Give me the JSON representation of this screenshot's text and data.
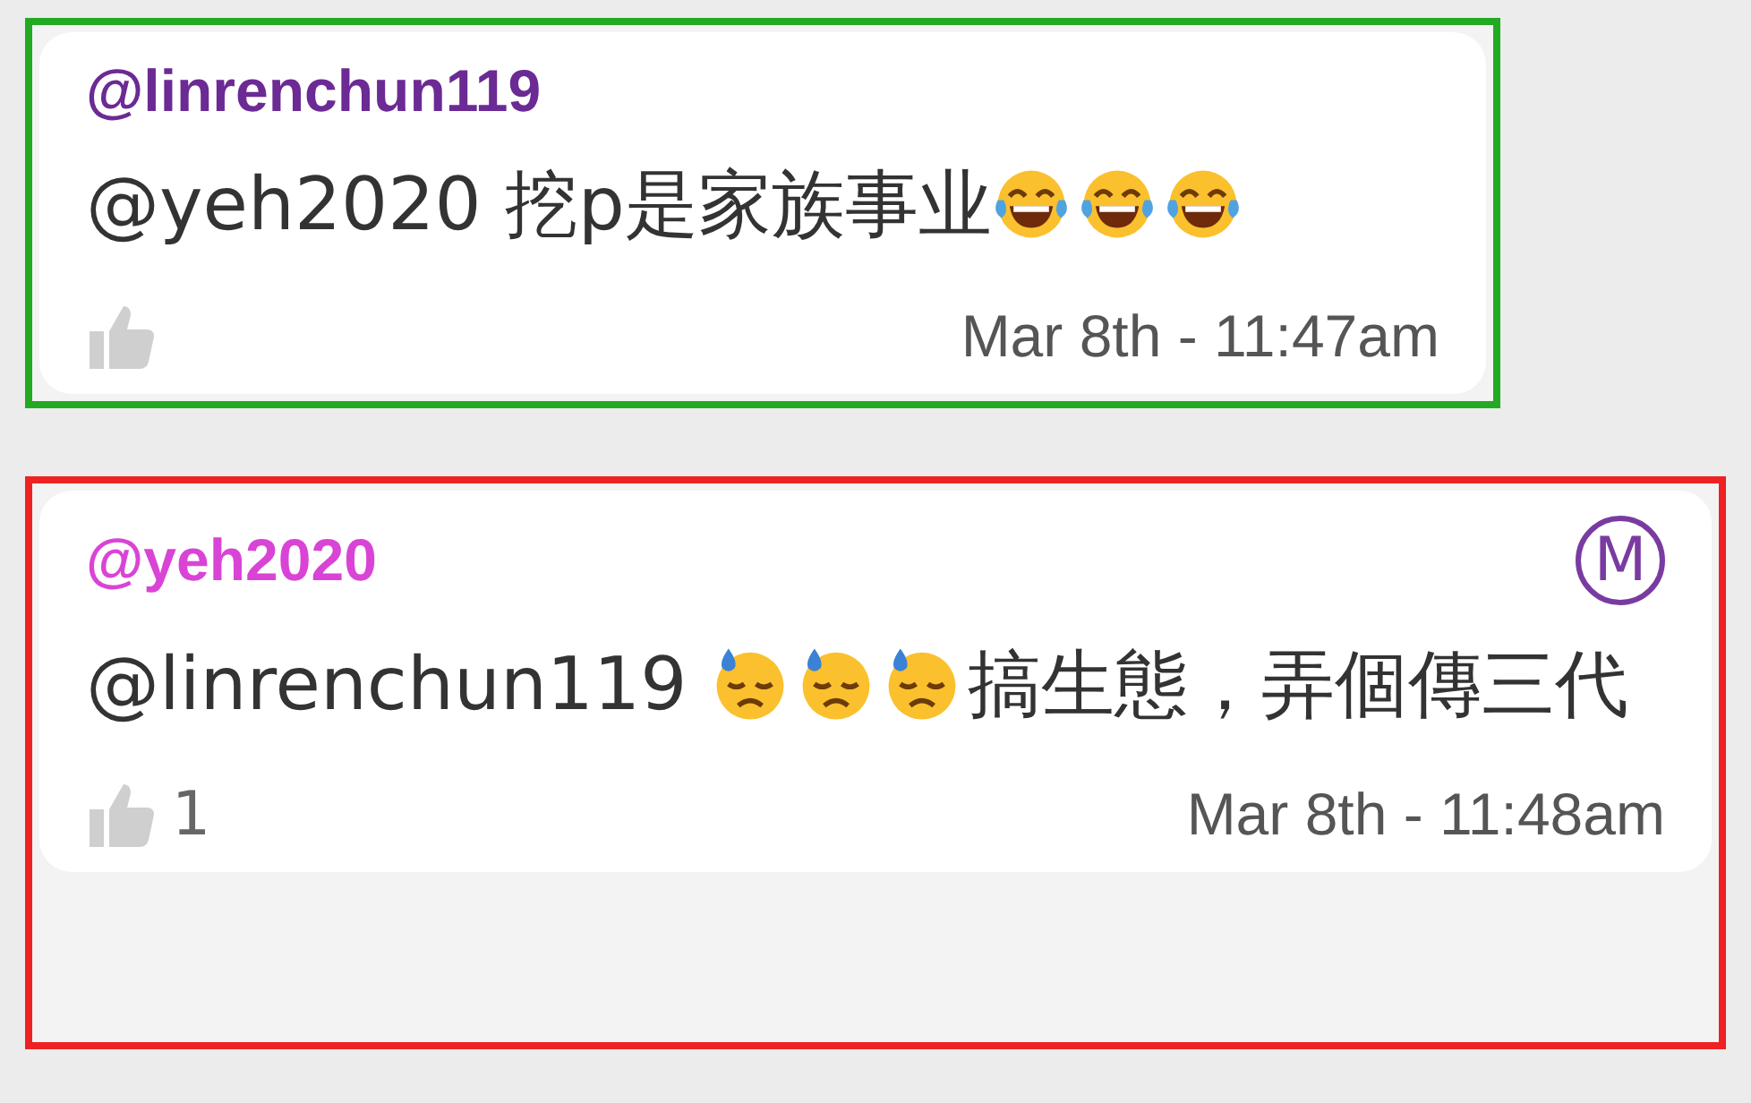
{
  "comments": [
    {
      "color": "#22aa22",
      "author": "@linrenchun119",
      "moderator": false,
      "message": [
        {
          "kind": "text",
          "text": "@yeh2020 挖p是家族事业"
        },
        {
          "kind": "laugh"
        },
        {
          "kind": "laugh"
        },
        {
          "kind": "laugh"
        }
      ],
      "time": "Mar 8th - 11:47am"
    },
    {
      "color": "#ee2222",
      "author": "@yeh2020",
      "moderator": true,
      "moderator_label": "M",
      "message": [
        {
          "kind": "text",
          "text": "@linrenchun119 "
        },
        {
          "kind": "sweat"
        },
        {
          "kind": "sweat"
        },
        {
          "kind": "sweat"
        },
        {
          "kind": "text",
          "text": "搞生態，弄個傳三代"
        }
      ],
      "likes": "1",
      "time": "Mar 8th - 11:48am"
    }
  ]
}
